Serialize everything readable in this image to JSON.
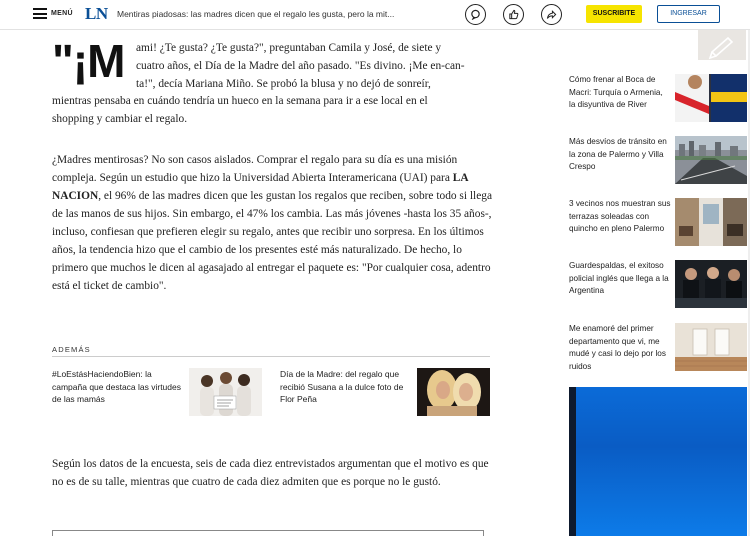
{
  "header": {
    "menu_label": "MENÚ",
    "logo": "LN",
    "headline": "Mentiras piadosas: las madres dicen que el regalo les gusta, pero la mit...",
    "icons": [
      "comment-icon",
      "thumbs-up-icon",
      "share-icon"
    ],
    "subscribe_label": "SUSCRIBITE",
    "login_label": "INGRESAR",
    "accent_color": "#0a4f96",
    "subscribe_color": "#f6e400"
  },
  "article": {
    "dropcap": "\"¡M",
    "p1_lines": [
      "ami! ¿Te gusta? ¿Te gusta?\", preguntaban Camila y José, de siete y",
      "cuatro años, el Día de la Madre del año pasado. \"Es divino. ¡Me en-can-",
      "ta!\", decía Mariana Miño. Se probó la blusa y no dejó de sonreír,",
      "mientras pensaba en cuándo tendría un hueco en la semana para ir a ese local en el",
      "shopping y cambiar el regalo."
    ],
    "p2_before": "¿Madres mentirosas? No son casos aislados. Comprar el regalo para su día es una misión compleja. Según un estudio que hizo la Universidad Abierta Interamericana (UAI) para ",
    "p2_bold": "LA NACION",
    "p2_after": ", el 96% de las madres dicen que les gustan los regalos que reciben, sobre todo si llega de las manos de sus hijos. Sin embargo, el 47% los cambia. Las más jóvenes -hasta los 35 años-, incluso, confiesan que prefieren elegir su regalo, antes que recibir uno sorpresa. En los últimos años, la tendencia hizo que el cambio de los presentes esté más naturalizado. De hecho, lo primero que muchos le dicen al agasajado al entregar el paquete es: \"Por cualquier cosa, adentro está el ticket de cambio\".",
    "p3": "Según los datos de la encuesta, seis de cada diez entrevistados argumentan que el motivo es que no es de su talle, mientras que cuatro de cada diez admiten que es porque no le gustó."
  },
  "ademas": {
    "label": "ADEMÁS",
    "items": [
      {
        "title": "#LoEstásHaciendoBien: la campaña que destaca las virtudes de las mamás",
        "image": "three-women-photo"
      },
      {
        "title": "Día de la Madre: del regalo que recibió Susana a la dulce foto de Flor Peña",
        "image": "two-women-photo"
      }
    ]
  },
  "sidebar": {
    "items": [
      {
        "title": "Cómo frenar al Boca de Macri: Turquía o Armenia, la disyuntiva de River",
        "image": "soccer-players-photo"
      },
      {
        "title": "Más desvíos de tránsito en la zona de Palermo y Villa Crespo",
        "image": "city-aerial-photo"
      },
      {
        "title": "3 vecinos nos muestran sus terrazas soleadas con quincho en pleno Palermo",
        "image": "terrace-photo"
      },
      {
        "title": "Guardespaldas, el exitoso policial inglés que llega a la Argentina",
        "image": "tv-series-photo"
      },
      {
        "title": "Me enamoré del primer departamento que vi, me mudé y casi lo dejo por los ruidos",
        "image": "apartment-photo"
      }
    ]
  }
}
